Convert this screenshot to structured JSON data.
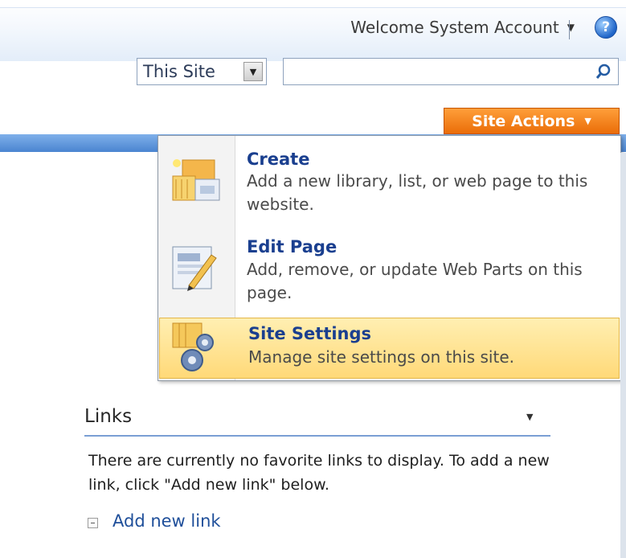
{
  "header": {
    "welcome_text": "Welcome System Account",
    "help_label": "?"
  },
  "search": {
    "scope_value": "This Site",
    "input_placeholder": "",
    "go_icon": "search-icon"
  },
  "site_actions": {
    "label": "Site Actions"
  },
  "menu": {
    "items": [
      {
        "title": "Create",
        "description": "Add a new library, list, or web page to this website.",
        "icon": "create-icon"
      },
      {
        "title": "Edit Page",
        "description": "Add, remove, or update Web Parts on this page.",
        "icon": "edit-page-icon"
      },
      {
        "title": "Site Settings",
        "description": "Manage site settings on this site.",
        "icon": "site-settings-icon",
        "selected": true
      }
    ]
  },
  "links_webpart": {
    "title": "Links",
    "empty_message": "There are currently no favorite links to display. To add a new link, click \"Add new link\" below.",
    "add_link_label": "Add new link"
  },
  "colors": {
    "site_actions_bg": "#ea6d08",
    "selected_item_bg": "#ffd978",
    "menu_title_color": "#1a3f8f",
    "band_blue": "#4a84d0"
  }
}
